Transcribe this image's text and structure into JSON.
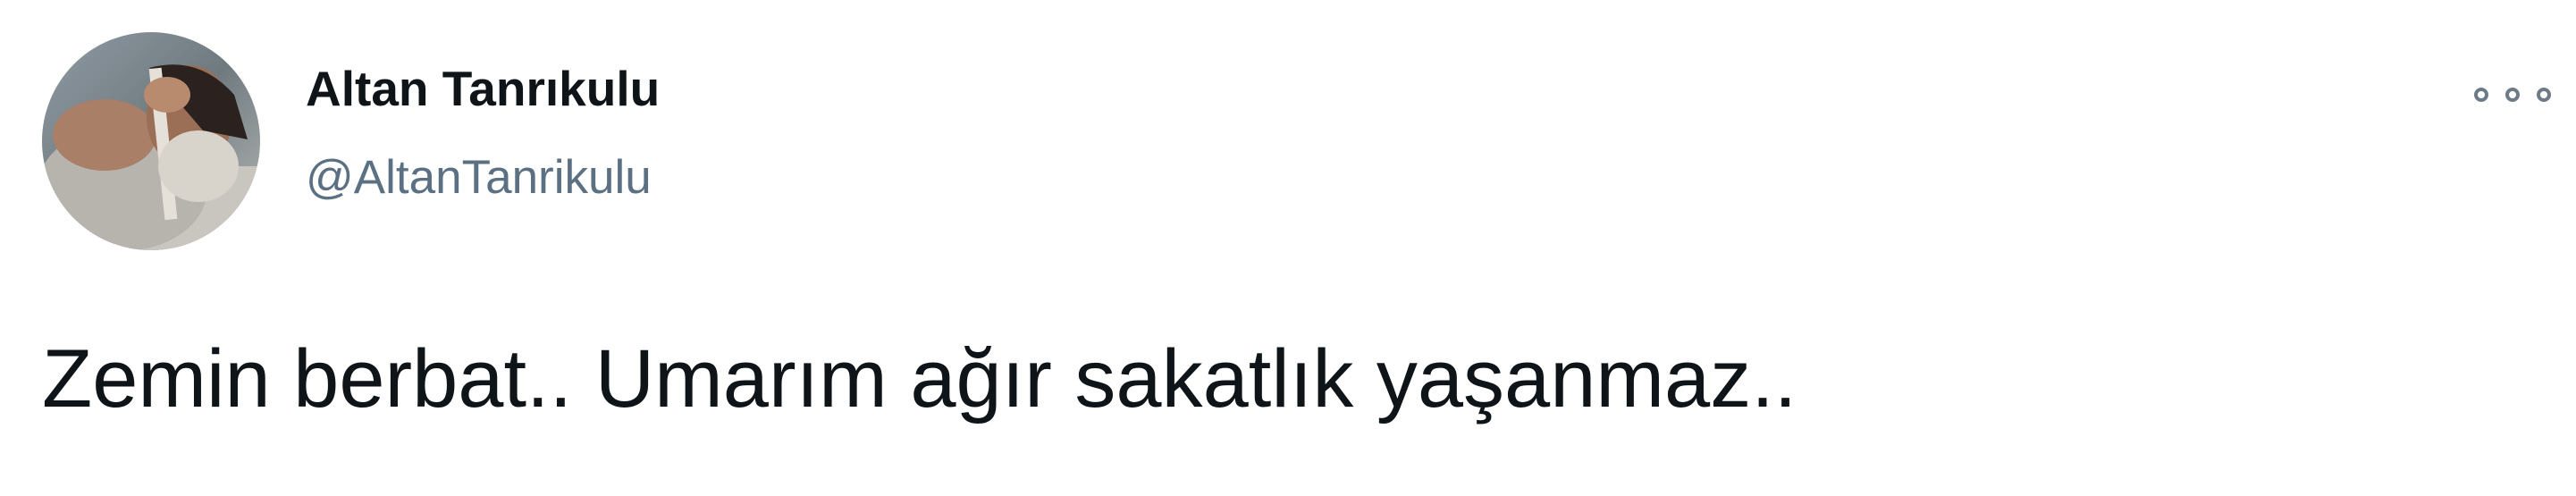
{
  "tweet": {
    "author": {
      "display_name": "Altan Tanrıkulu",
      "handle": "@AltanTanrikulu",
      "avatar_icon": "profile-photo"
    },
    "more_icon": "more-options-icon",
    "text": "Zemin berbat.. Umarım ağır sakatlık yaşanmaz.."
  },
  "colors": {
    "background": "#ffffff",
    "name": "#0f1419",
    "handle": "#5b7083",
    "text": "#0f1419"
  }
}
